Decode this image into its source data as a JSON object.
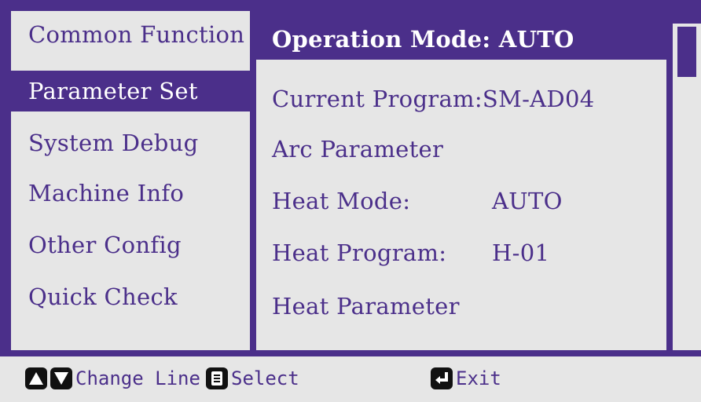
{
  "menu": {
    "items": [
      {
        "label": "Common Function"
      },
      {
        "label": "Parameter Set"
      },
      {
        "label": "System Debug"
      },
      {
        "label": "Machine Info"
      },
      {
        "label": "Other Config"
      },
      {
        "label": "Quick Check"
      }
    ],
    "selected_index": 1
  },
  "params": {
    "operation_mode": "Operation Mode: AUTO",
    "current_program": "Current Program:SM-AD04",
    "arc_parameter": "Arc Parameter",
    "heat_mode_label": "Heat Mode:",
    "heat_mode_value": "AUTO",
    "heat_program_label": "Heat Program:",
    "heat_program_value": "H-01",
    "heat_parameter": "Heat Parameter"
  },
  "footer": {
    "change_line": "Change Line",
    "select": "Select",
    "exit": "Exit"
  },
  "colors": {
    "accent": "#4b2f8a",
    "background": "#e6e6e6",
    "key_icon": "#111111"
  }
}
